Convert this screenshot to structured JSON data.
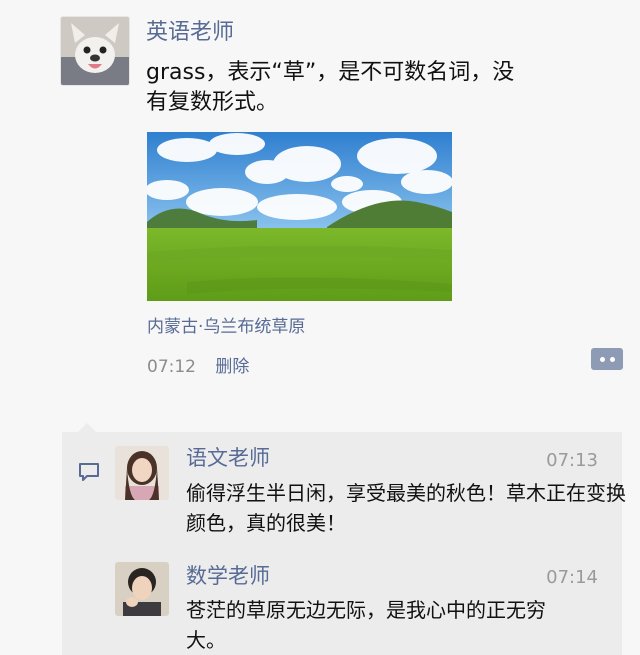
{
  "post": {
    "author": "英语老师",
    "text": "grass，表示“草”，是不可数名词，没有复数形式。",
    "image_alt": "grassland-photo",
    "location": "内蒙古·乌兰布统草原",
    "time": "07:12",
    "delete_label": "删除",
    "more_icon": "more-dots-icon"
  },
  "comments": [
    {
      "author": "语文老师",
      "time": "07:13",
      "text": "偷得浮生半日闲，享受最美的秋色！草木正在变换颜色，真的很美！"
    },
    {
      "author": "数学老师",
      "time": "07:14",
      "text": "苍茫的草原无边无际，是我心中的正无穷大。"
    }
  ],
  "colors": {
    "link": "#576b95",
    "comment_bg": "#ececec",
    "background": "#f7f7f7"
  }
}
